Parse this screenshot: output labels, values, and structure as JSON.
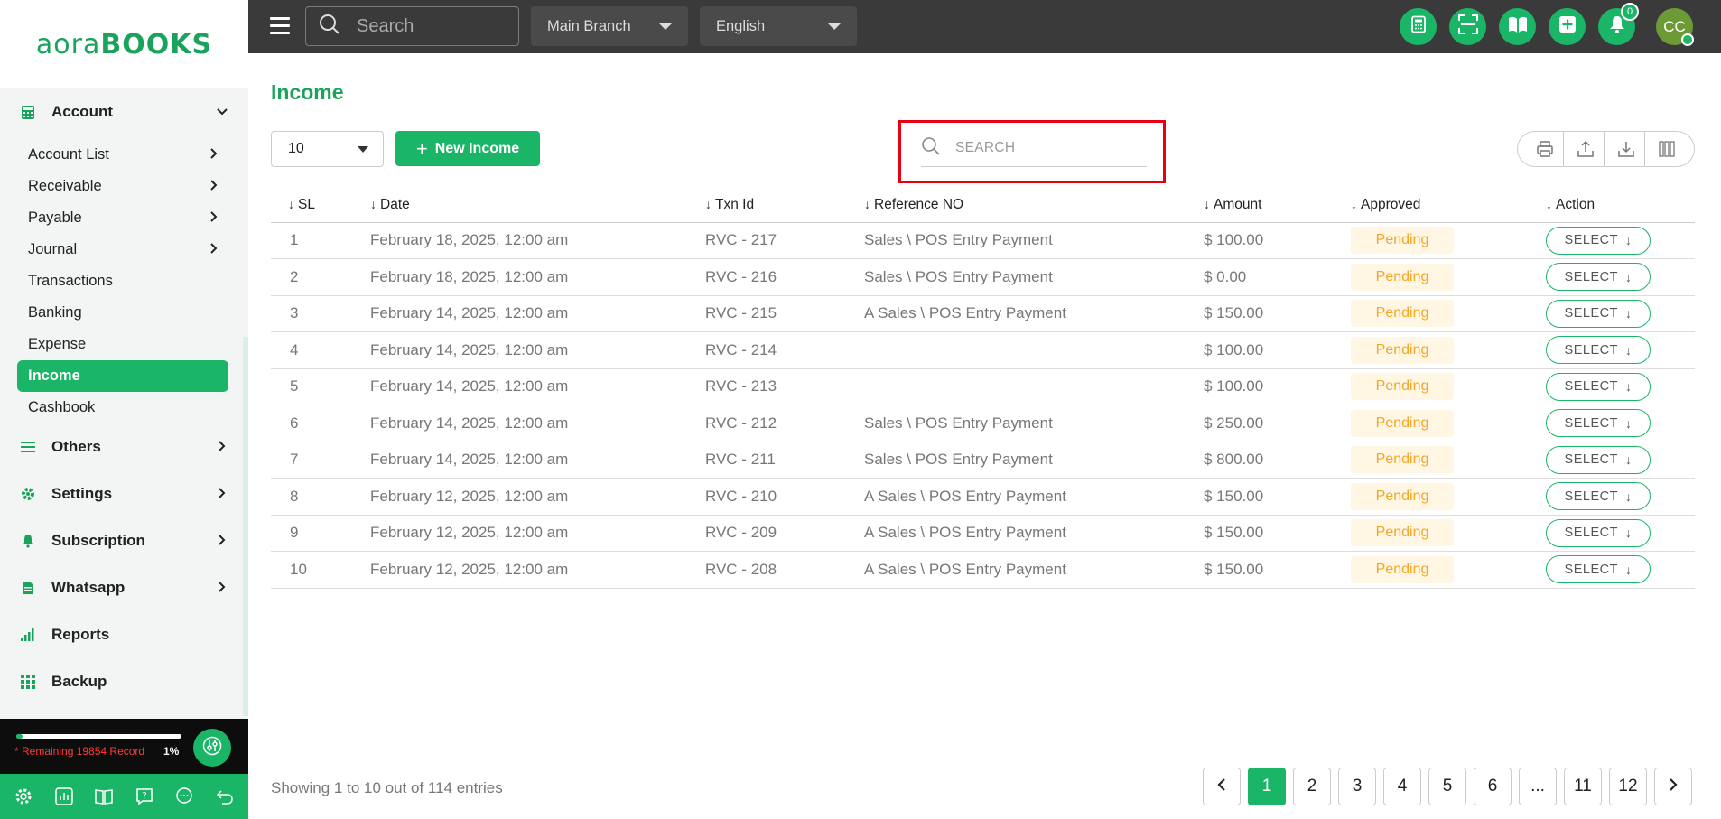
{
  "brand": {
    "logo_light": "aora",
    "logo_bold": "BOOKS"
  },
  "sidebar": {
    "account_group": {
      "label": "Account",
      "icon": "calculator-icon"
    },
    "account_items": [
      {
        "label": "Account List",
        "has_submenu": true
      },
      {
        "label": "Receivable",
        "has_submenu": true
      },
      {
        "label": "Payable",
        "has_submenu": true
      },
      {
        "label": "Journal",
        "has_submenu": true
      },
      {
        "label": "Transactions",
        "has_submenu": false
      },
      {
        "label": "Banking",
        "has_submenu": false
      },
      {
        "label": "Expense",
        "has_submenu": false
      },
      {
        "label": "Income",
        "has_submenu": false,
        "active": true
      },
      {
        "label": "Cashbook",
        "has_submenu": false
      }
    ],
    "groups": [
      {
        "label": "Others",
        "icon": "list-icon"
      },
      {
        "label": "Settings",
        "icon": "gear-icon"
      },
      {
        "label": "Subscription",
        "icon": "bell-icon"
      },
      {
        "label": "Whatsapp",
        "icon": "document-icon"
      },
      {
        "label": "Reports",
        "icon": "signal-bars-icon"
      },
      {
        "label": "Backup",
        "icon": "grid-icon"
      }
    ],
    "quota": {
      "text": "* Remaining 19854 Record",
      "percent_label": "1%",
      "percent": 0.01
    },
    "bottom_icons": [
      "gear-icon",
      "chart-icon",
      "book-icon",
      "help-icon",
      "chat-icon",
      "undo-icon"
    ]
  },
  "topbar": {
    "search_placeholder": "Search",
    "branch": "Main Branch",
    "language": "English",
    "icons": [
      "calculator-icon",
      "scan-icon",
      "book-icon",
      "add-icon",
      "bell-icon"
    ],
    "notification_count": "0",
    "avatar_initials": "CC"
  },
  "page": {
    "title": "Income",
    "per_page": "10",
    "new_button": "New Income",
    "search_placeholder": "SEARCH",
    "tools": [
      "print-icon",
      "upload-icon",
      "download-icon",
      "barcode-icon"
    ]
  },
  "table": {
    "headers": [
      "SL",
      "Date",
      "Txn Id",
      "Reference NO",
      "Amount",
      "Approved",
      "Action"
    ],
    "rows": [
      {
        "sl": "1",
        "date": "February 18, 2025, 12:00 am",
        "txn": "RVC - 217",
        "ref": "Sales \\ POS Entry Payment",
        "amount": "$ 100.00",
        "status": "Pending",
        "action": "SELECT"
      },
      {
        "sl": "2",
        "date": "February 18, 2025, 12:00 am",
        "txn": "RVC - 216",
        "ref": "Sales \\ POS Entry Payment",
        "amount": "$ 0.00",
        "status": "Pending",
        "action": "SELECT"
      },
      {
        "sl": "3",
        "date": "February 14, 2025, 12:00 am",
        "txn": "RVC - 215",
        "ref": "A Sales \\ POS Entry Payment",
        "amount": "$ 150.00",
        "status": "Pending",
        "action": "SELECT"
      },
      {
        "sl": "4",
        "date": "February 14, 2025, 12:00 am",
        "txn": "RVC - 214",
        "ref": "",
        "amount": "$ 100.00",
        "status": "Pending",
        "action": "SELECT"
      },
      {
        "sl": "5",
        "date": "February 14, 2025, 12:00 am",
        "txn": "RVC - 213",
        "ref": "",
        "amount": "$ 100.00",
        "status": "Pending",
        "action": "SELECT"
      },
      {
        "sl": "6",
        "date": "February 14, 2025, 12:00 am",
        "txn": "RVC - 212",
        "ref": "Sales \\ POS Entry Payment",
        "amount": "$ 250.00",
        "status": "Pending",
        "action": "SELECT"
      },
      {
        "sl": "7",
        "date": "February 14, 2025, 12:00 am",
        "txn": "RVC - 211",
        "ref": "Sales \\ POS Entry Payment",
        "amount": "$ 800.00",
        "status": "Pending",
        "action": "SELECT"
      },
      {
        "sl": "8",
        "date": "February 12, 2025, 12:00 am",
        "txn": "RVC - 210",
        "ref": "A Sales \\ POS Entry Payment",
        "amount": "$ 150.00",
        "status": "Pending",
        "action": "SELECT"
      },
      {
        "sl": "9",
        "date": "February 12, 2025, 12:00 am",
        "txn": "RVC - 209",
        "ref": "A Sales \\ POS Entry Payment",
        "amount": "$ 150.00",
        "status": "Pending",
        "action": "SELECT"
      },
      {
        "sl": "10",
        "date": "February 12, 2025, 12:00 am",
        "txn": "RVC - 208",
        "ref": "A Sales \\ POS Entry Payment",
        "amount": "$ 150.00",
        "status": "Pending",
        "action": "SELECT"
      }
    ]
  },
  "footer": {
    "info": "Showing 1 to 10 out of 114 entries",
    "pages": [
      "1",
      "2",
      "3",
      "4",
      "5",
      "6",
      "...",
      "11",
      "12"
    ],
    "current_page": "1"
  },
  "colors": {
    "accent": "#1ab566",
    "topbar": "#3a3a3a",
    "pending_text": "#f5a623",
    "highlight_border": "#e60012"
  }
}
